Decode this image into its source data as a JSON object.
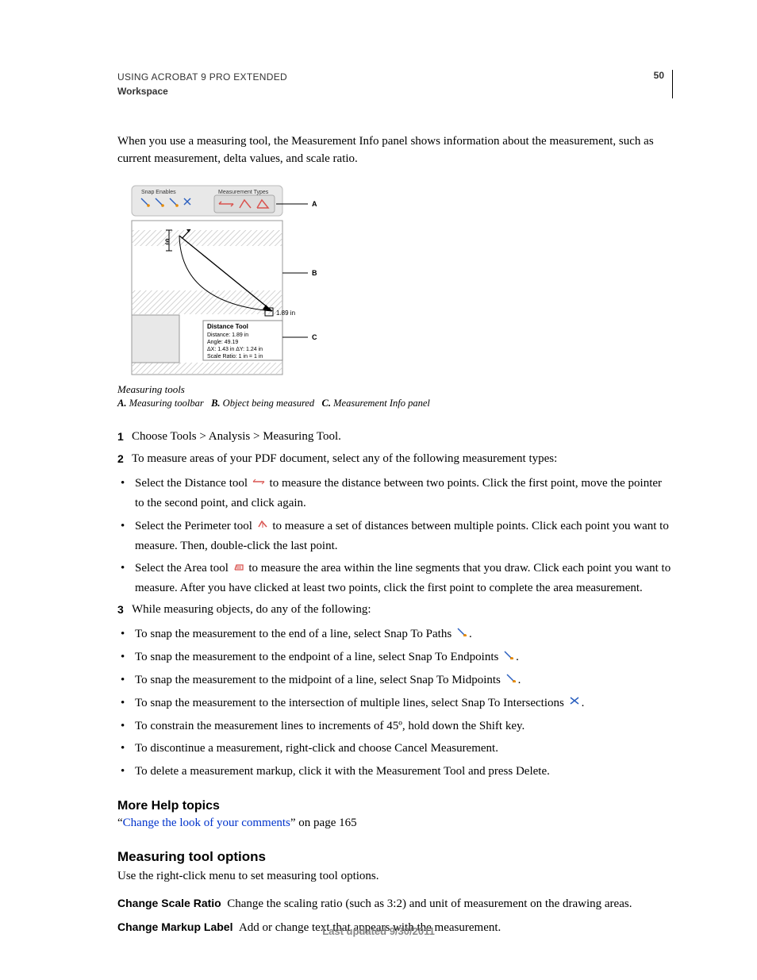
{
  "header": {
    "line1": "USING ACROBAT 9 PRO EXTENDED",
    "line2": "Workspace",
    "page_number": "50"
  },
  "intro": "When you use a measuring tool, the Measurement Info panel shows information about the measurement, such as current measurement, delta values, and scale ratio.",
  "figure": {
    "toolbar": {
      "snap_label": "Snap Enables",
      "meas_label": "Measurement Types"
    },
    "info_panel": {
      "title": "Distance Tool",
      "distance": "Distance: 1.89 in",
      "angle": "Angle: 49.19",
      "delta": "ΔX: 1.43 in   ΔY: 1.24 in",
      "scale": "Scale Ratio: 1 in = 1 in"
    },
    "dim_label": "1.89 in",
    "labels": {
      "a": "A",
      "b": "B",
      "c": "C"
    }
  },
  "caption": {
    "main": "Measuring tools",
    "a_lbl": "A.",
    "a_txt": "Measuring toolbar",
    "b_lbl": "B.",
    "b_txt": "Object being measured",
    "c_lbl": "C.",
    "c_txt": "Measurement Info panel"
  },
  "steps": {
    "s1": "Choose Tools > Analysis > Measuring Tool.",
    "s2": "To measure areas of your PDF document, select any of the following measurement types:",
    "s3": "While measuring objects, do any of the following:"
  },
  "tools": {
    "distance_pre": "Select the Distance tool ",
    "distance_post": " to measure the distance between two points. Click the first point, move the pointer to the second point, and click again.",
    "perimeter_pre": "Select the Perimeter tool ",
    "perimeter_post": " to measure a set of distances between multiple points. Click each point you want to measure. Then, double-click the last point.",
    "area_pre": "Select the Area tool ",
    "area_post": " to measure the area within the line segments that you draw. Click each point you want to measure. After you have clicked at least two points, click the first point to complete the area measurement."
  },
  "snaps": {
    "paths_pre": "To snap the measurement to the end of a line, select Snap To Paths ",
    "endpoints_pre": "To snap the measurement to the endpoint of a line, select Snap To Endpoints ",
    "midpoints_pre": "To snap the measurement to the midpoint of a line, select Snap To Midpoints ",
    "intersections_pre": "To snap the measurement to the intersection of multiple lines, select Snap To Intersections ",
    "period": "."
  },
  "misc": {
    "constrain": "To constrain the measurement lines to increments of 45º, hold down the Shift key.",
    "discontinue": "To discontinue a measurement, right-click and choose Cancel Measurement.",
    "delete": "To delete a measurement markup, click it with the Measurement Tool and press Delete."
  },
  "help": {
    "heading": "More Help topics",
    "quote_open": "“",
    "link_text": "Change the look of your comments",
    "suffix": "” on page 165"
  },
  "options": {
    "heading": "Measuring tool options",
    "intro": "Use the right-click menu to set measuring tool options.",
    "scale_lbl": "Change Scale Ratio",
    "scale_txt": "Change the scaling ratio (such as 3:2) and unit of measurement on the drawing areas.",
    "markup_lbl": "Change Markup Label",
    "markup_txt": "Add or change text that appears with the measurement."
  },
  "footer": "Last updated 9/30/2011"
}
